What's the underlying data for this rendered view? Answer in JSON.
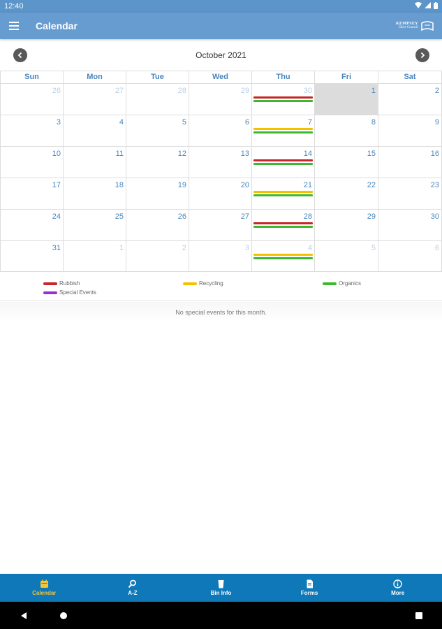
{
  "status": {
    "time": "12:40"
  },
  "app_bar": {
    "title": "Calendar"
  },
  "logo": {
    "line1": "KEMPSEY",
    "line2": "Shire Council"
  },
  "calendar": {
    "month_label": "October 2021",
    "day_headers": [
      "Sun",
      "Mon",
      "Tue",
      "Wed",
      "Thu",
      "Fri",
      "Sat"
    ],
    "weeks": [
      [
        {
          "d": "26",
          "o": true
        },
        {
          "d": "27",
          "o": true
        },
        {
          "d": "28",
          "o": true
        },
        {
          "d": "29",
          "o": true
        },
        {
          "d": "30",
          "o": true,
          "b": [
            "rubbish",
            "organics"
          ]
        },
        {
          "d": "1",
          "today": true
        },
        {
          "d": "2"
        }
      ],
      [
        {
          "d": "3"
        },
        {
          "d": "4"
        },
        {
          "d": "5"
        },
        {
          "d": "6"
        },
        {
          "d": "7",
          "b": [
            "recycling",
            "organics"
          ]
        },
        {
          "d": "8"
        },
        {
          "d": "9"
        }
      ],
      [
        {
          "d": "10"
        },
        {
          "d": "11"
        },
        {
          "d": "12"
        },
        {
          "d": "13"
        },
        {
          "d": "14",
          "b": [
            "rubbish",
            "organics"
          ]
        },
        {
          "d": "15"
        },
        {
          "d": "16"
        }
      ],
      [
        {
          "d": "17"
        },
        {
          "d": "18"
        },
        {
          "d": "19"
        },
        {
          "d": "20"
        },
        {
          "d": "21",
          "b": [
            "recycling",
            "organics"
          ]
        },
        {
          "d": "22"
        },
        {
          "d": "23"
        }
      ],
      [
        {
          "d": "24"
        },
        {
          "d": "25"
        },
        {
          "d": "26"
        },
        {
          "d": "27"
        },
        {
          "d": "28",
          "b": [
            "rubbish",
            "organics"
          ]
        },
        {
          "d": "29"
        },
        {
          "d": "30"
        }
      ],
      [
        {
          "d": "31"
        },
        {
          "d": "1",
          "o": true
        },
        {
          "d": "2",
          "o": true
        },
        {
          "d": "3",
          "o": true
        },
        {
          "d": "4",
          "o": true,
          "b": [
            "recycling",
            "organics"
          ]
        },
        {
          "d": "5",
          "o": true
        },
        {
          "d": "6",
          "o": true
        }
      ]
    ]
  },
  "legend": {
    "rubbish": {
      "label": "Rubbish",
      "color": "#c8262c"
    },
    "recycling": {
      "label": "Recycling",
      "color": "#f2c200"
    },
    "organics": {
      "label": "Organics",
      "color": "#3cba2f"
    },
    "special": {
      "label": "Special Events",
      "color": "#9b2fd1"
    }
  },
  "events": {
    "empty_message": "No special events for this month."
  },
  "bottom_nav": {
    "tabs": [
      {
        "label": "Calendar",
        "icon": "calendar-icon",
        "active": true
      },
      {
        "label": "A-Z",
        "icon": "search-icon",
        "active": false
      },
      {
        "label": "Bin Info",
        "icon": "bin-icon",
        "active": false
      },
      {
        "label": "Forms",
        "icon": "document-icon",
        "active": false
      },
      {
        "label": "More",
        "icon": "info-icon",
        "active": false
      }
    ]
  },
  "colors": {
    "app_bar": "#669ccf",
    "bottom_nav": "#0f78b8",
    "active_tab": "#f2c43c",
    "day_text": "#4a86bd"
  }
}
